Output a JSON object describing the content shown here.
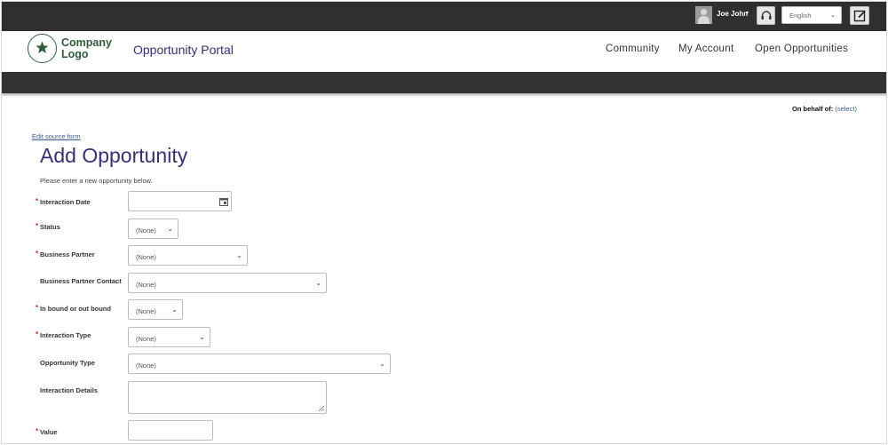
{
  "topbar": {
    "user_name": "Joe John",
    "user_caret": "▾",
    "language": "English",
    "language_caret": "⌄"
  },
  "header": {
    "logo_text": "Company Logo",
    "portal_title": "Opportunity Portal",
    "nav": [
      "Community",
      "My Account",
      "Open Opportunities"
    ]
  },
  "content": {
    "on_behalf_label": "On behalf of:",
    "on_behalf_link": "(select)",
    "edit_source_link": "Edit source form",
    "title": "Add Opportunity",
    "instructions": "Please enter a new opportunity below."
  },
  "form": {
    "required_marker": "*",
    "fields": [
      {
        "label": "Interaction Date",
        "required": true,
        "type": "date",
        "value": ""
      },
      {
        "label": "Status",
        "required": true,
        "type": "select",
        "value": "(None)"
      },
      {
        "label": "Business Partner",
        "required": true,
        "type": "select",
        "value": "(None)"
      },
      {
        "label": "Business Partner Contact",
        "required": false,
        "type": "select",
        "value": "(None)"
      },
      {
        "label": "In bound or out bound",
        "required": true,
        "type": "select",
        "value": "(None)"
      },
      {
        "label": "Interaction Type",
        "required": true,
        "type": "select",
        "value": "(None)"
      },
      {
        "label": "Opportunity Type",
        "required": false,
        "type": "select",
        "value": "(None)"
      },
      {
        "label": "Interaction Details",
        "required": false,
        "type": "textarea",
        "value": ""
      },
      {
        "label": "Value",
        "required": true,
        "type": "text",
        "value": ""
      }
    ],
    "select_caret": "⌄"
  },
  "icons": {
    "user": "user-avatar-icon",
    "help": "headset-icon",
    "edit": "edit-icon",
    "logo": "star-icon",
    "calendar": "calendar-icon"
  },
  "colors": {
    "topbar": "#2f2f2f",
    "brand_green": "#2e5e3e",
    "title_purple": "#3b2d7a",
    "required_red": "#c0392b",
    "link_blue": "#3b5a9a"
  }
}
